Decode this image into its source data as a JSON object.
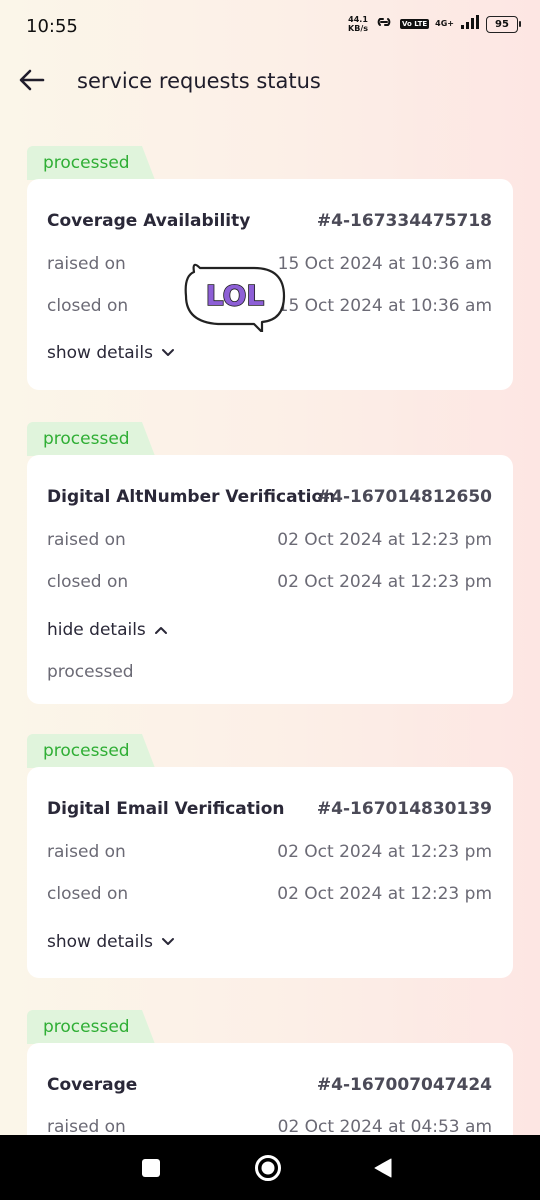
{
  "status_bar": {
    "time": "10:55",
    "net_speed_value": "44.1",
    "net_speed_unit": "KB/s",
    "volte": "Vo LTE",
    "network": "4G+",
    "battery": "95"
  },
  "header": {
    "title": "service requests status",
    "back_icon": "arrow-left-icon"
  },
  "sticker_text": "LOL",
  "requests": [
    {
      "status": "processed",
      "name": "Coverage Availability",
      "id": "#4-167334475718",
      "raised_label": "raised on",
      "raised": "15 Oct 2024 at 10:36 am",
      "closed_label": "closed on",
      "closed": "15 Oct 2024 at 10:36 am",
      "toggle": "show details"
    },
    {
      "status": "processed",
      "name": "Digital AltNumber Verification",
      "id": "#4-167014812650",
      "raised_label": "raised on",
      "raised": "02 Oct 2024 at 12:23 pm",
      "closed_label": "closed on",
      "closed": "02 Oct 2024 at 12:23 pm",
      "toggle": "hide details",
      "details": "processed"
    },
    {
      "status": "processed",
      "name": "Digital Email Verification",
      "id": "#4-167014830139",
      "raised_label": "raised on",
      "raised": "02 Oct 2024 at 12:23 pm",
      "closed_label": "closed on",
      "closed": "02 Oct 2024 at 12:23 pm",
      "toggle": "show details"
    },
    {
      "status": "processed",
      "name": "Coverage",
      "id": "#4-167007047424",
      "raised_label": "raised on",
      "raised": "02 Oct 2024 at 04:53 am"
    }
  ],
  "colors": {
    "badge_bg": "#e0f4dc",
    "badge_text": "#2fae35",
    "card_bg": "#ffffff",
    "nav_bar": "#000000"
  }
}
